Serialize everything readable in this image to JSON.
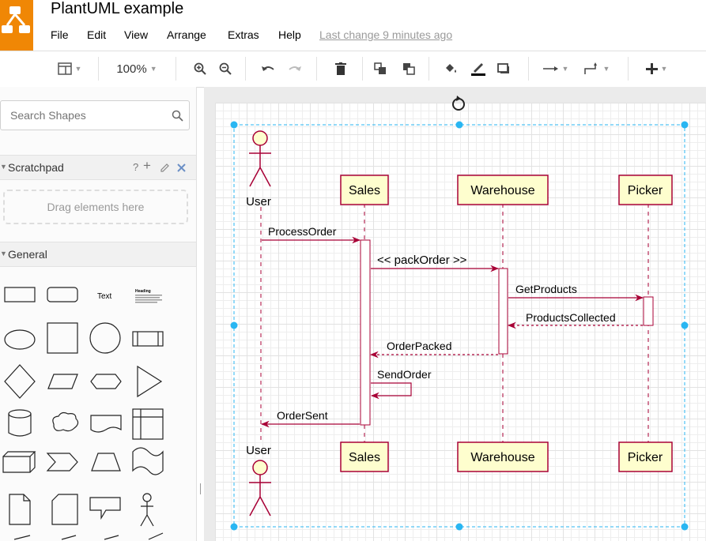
{
  "header": {
    "title": "PlantUML example",
    "menus": [
      "File",
      "Edit",
      "View",
      "Arrange",
      "Extras",
      "Help"
    ],
    "last_change": "Last change 9 minutes ago"
  },
  "toolbar": {
    "zoom": "100%",
    "icons": [
      "format-panel-icon",
      "zoom-in-icon",
      "zoom-out-icon",
      "undo-icon",
      "redo-icon",
      "delete-icon",
      "to-front-icon",
      "to-back-icon",
      "fill-color-icon",
      "line-color-icon",
      "shadow-icon",
      "connection-icon",
      "waypoints-icon",
      "insert-icon"
    ]
  },
  "sidebar": {
    "search_placeholder": "Search Shapes",
    "scratchpad": {
      "label": "Scratchpad",
      "help": "?",
      "drop_text": "Drag elements here"
    },
    "general": {
      "label": "General",
      "text_shape": "Text",
      "heading_shape": "Heading"
    }
  },
  "diagram": {
    "participants": [
      "Sales",
      "Warehouse",
      "Picker"
    ],
    "actor": "User",
    "messages": [
      "ProcessOrder",
      "<< packOrder >>",
      "GetProducts",
      "ProductsCollected",
      "OrderPacked",
      "SendOrder",
      "OrderSent"
    ]
  },
  "colors": {
    "brand": "#f08705",
    "participant_fill": "#fefece",
    "participant_border": "#a80036",
    "selection": "#29b6f2"
  }
}
